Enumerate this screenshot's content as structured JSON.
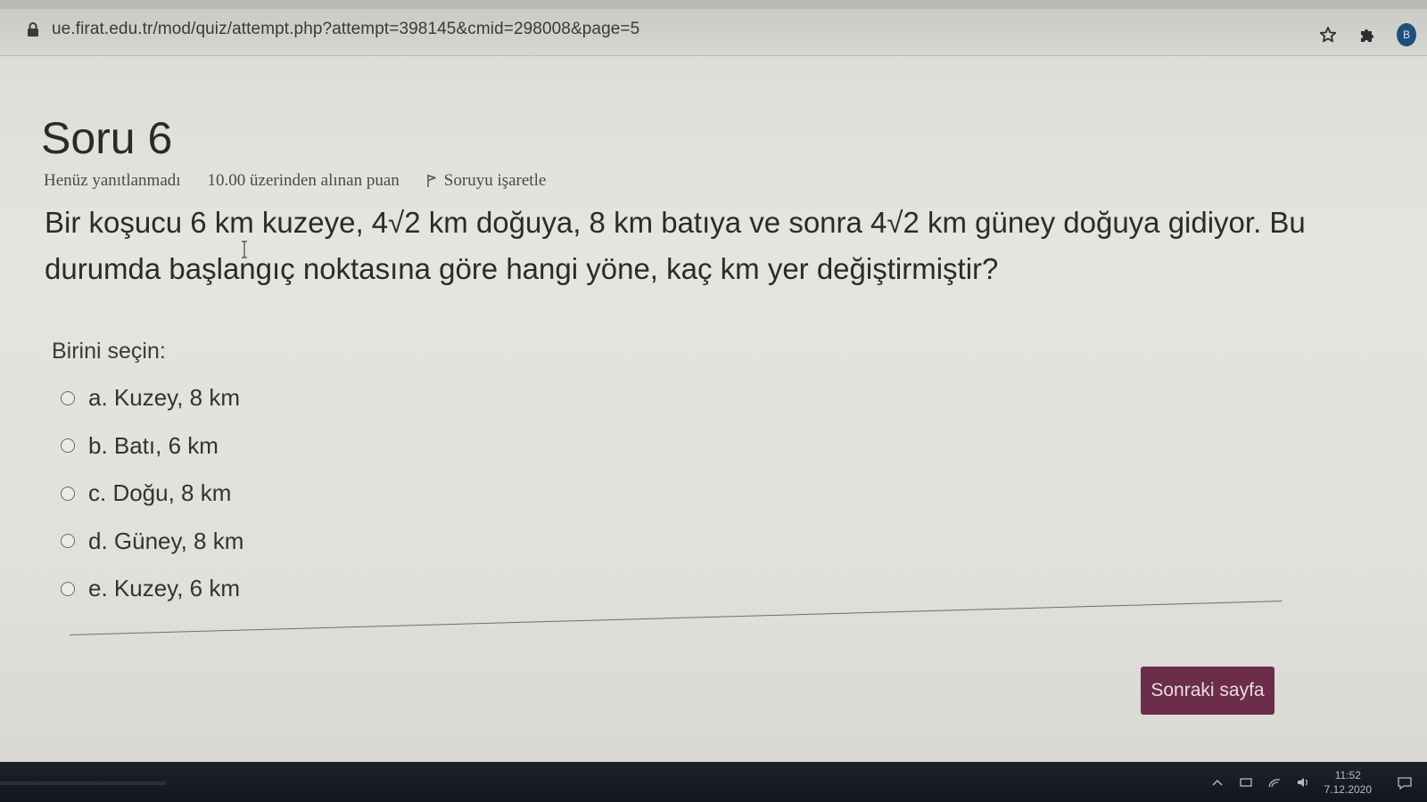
{
  "browser": {
    "url": "ue.firat.edu.tr/mod/quiz/attempt.php?attempt=398145&cmid=298008&page=5",
    "profile_initial": "B"
  },
  "question": {
    "title": "Soru 6",
    "status": "Henüz yanıtlanmadı",
    "points": "10.00 üzerinden alınan puan",
    "flag_label": "Soruyu işaretle",
    "text": "Bir koşucu 6 km kuzeye, 4√2 km doğuya, 8 km batıya ve sonra 4√2 km güney doğuya gidiyor. Bu durumda başlangıç noktasına göre hangi yöne, kaç km yer değiştirmiştir?",
    "choose_label": "Birini seçin:",
    "answers": [
      {
        "label": "a. Kuzey, 8 km"
      },
      {
        "label": "b. Batı, 6 km"
      },
      {
        "label": "c. Doğu, 8 km"
      },
      {
        "label": "d. Güney, 8 km"
      },
      {
        "label": "e. Kuzey, 6 km"
      }
    ]
  },
  "navigation": {
    "next_label": "Sonraki sayfa"
  },
  "taskbar": {
    "time": "11:52",
    "date": "7.12.2020"
  },
  "colors": {
    "next_button": "#6b2d4a",
    "page_background": "#e4e2de"
  }
}
